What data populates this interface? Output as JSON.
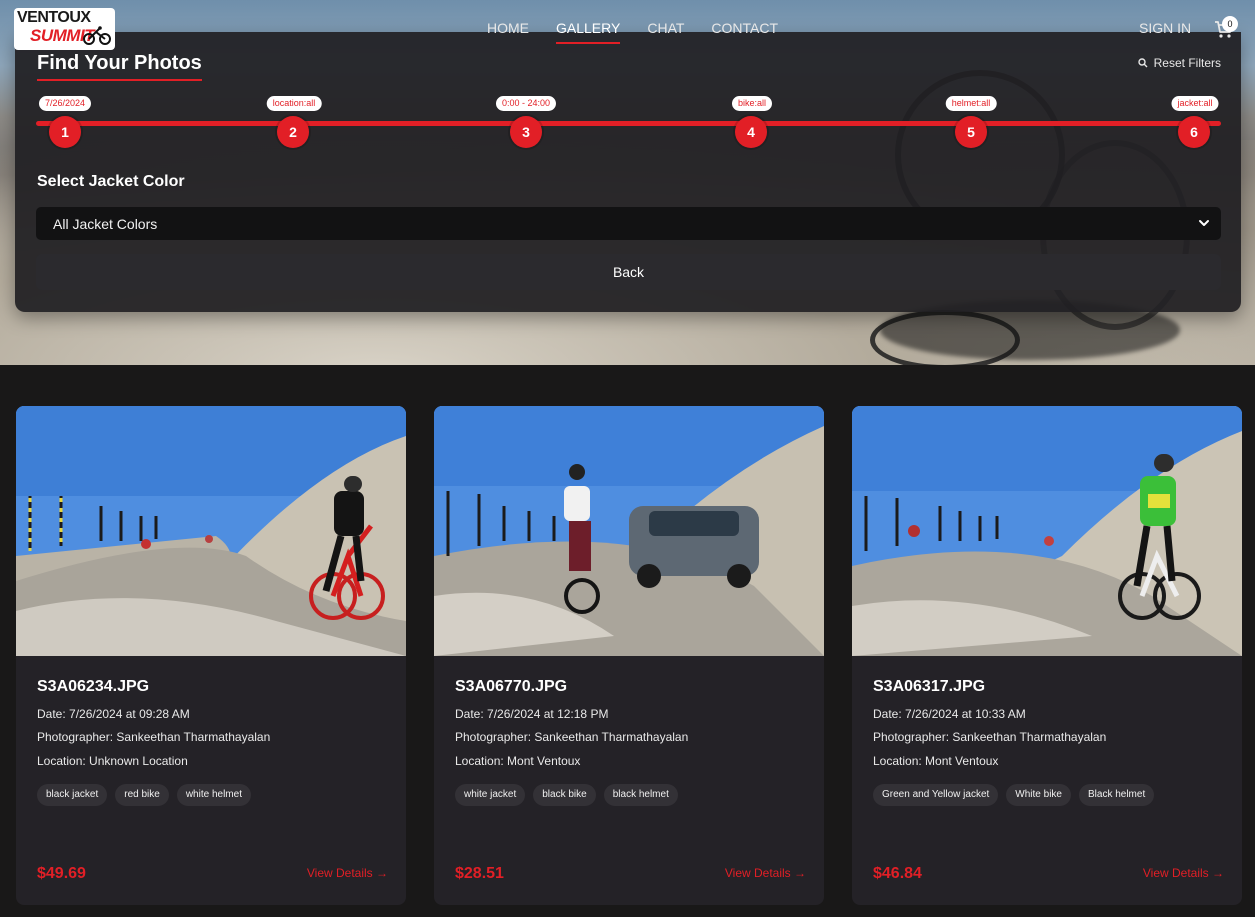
{
  "nav": {
    "logo_top": "VENTOUX",
    "logo_bottom": "SUMMIT",
    "links": [
      {
        "label": "HOME"
      },
      {
        "label": "GALLERY",
        "active": true
      },
      {
        "label": "CHAT"
      },
      {
        "label": "CONTACT"
      }
    ],
    "sign_in": "SIGN IN",
    "cart_count": "0"
  },
  "filters": {
    "title": "Find Your Photos",
    "reset_label": "Reset Filters",
    "steps": [
      {
        "number": "1",
        "tag": "7/26/2024"
      },
      {
        "number": "2",
        "tag": "location:all"
      },
      {
        "number": "3",
        "tag": "0:00 - 24:00"
      },
      {
        "number": "4",
        "tag": "bike:all"
      },
      {
        "number": "5",
        "tag": "helmet:all"
      },
      {
        "number": "6",
        "tag": "jacket:all"
      }
    ],
    "select_label": "Select Jacket Color",
    "select_value": "All Jacket Colors",
    "back_label": "Back"
  },
  "photos": [
    {
      "filename": "S3A06234.JPG",
      "date": "Date: 7/26/2024 at 09:28 AM",
      "photographer": "Photographer: Sankeethan Tharmathayalan",
      "location": "Location: Unknown Location",
      "tags": [
        "black jacket",
        "red bike",
        "white helmet"
      ],
      "price": "$49.69",
      "details_label": "View Details →"
    },
    {
      "filename": "S3A06770.JPG",
      "date": "Date: 7/26/2024 at 12:18 PM",
      "photographer": "Photographer: Sankeethan Tharmathayalan",
      "location": "Location: Mont Ventoux",
      "tags": [
        "white jacket",
        "black bike",
        "black helmet"
      ],
      "price": "$28.51",
      "details_label": "View Details →"
    },
    {
      "filename": "S3A06317.JPG",
      "date": "Date: 7/26/2024 at 10:33 AM",
      "photographer": "Photographer: Sankeethan Tharmathayalan",
      "location": "Location: Mont Ventoux",
      "tags": [
        "Green and Yellow jacket",
        "White bike",
        "Black helmet"
      ],
      "price": "$46.84",
      "details_label": "View Details →"
    }
  ],
  "colors": {
    "accent": "#e21f26",
    "page_bg": "#191818",
    "card_bg": "#242227"
  },
  "icons": [
    "search-icon",
    "cart-icon",
    "chevron-down-icon",
    "bike-logo-icon"
  ]
}
